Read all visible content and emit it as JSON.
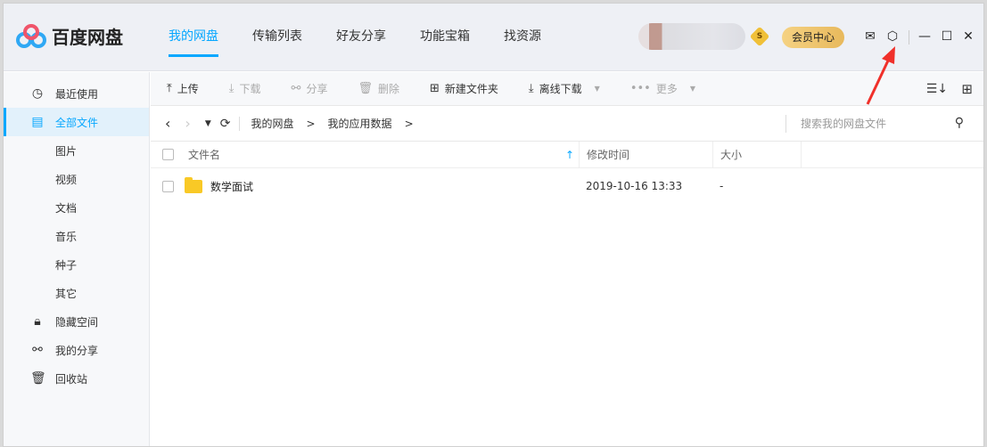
{
  "app": {
    "name": "百度网盘"
  },
  "nav": [
    "我的网盘",
    "传输列表",
    "好友分享",
    "功能宝箱",
    "找资源"
  ],
  "top": {
    "vip_badge": "S",
    "vip_center": "会员中心"
  },
  "sidebar": [
    {
      "label": "最近使用",
      "icon": "clock-icon",
      "glyph": "◷"
    },
    {
      "label": "全部文件",
      "icon": "document-icon",
      "glyph": "▤",
      "active": true
    },
    {
      "label": "图片"
    },
    {
      "label": "视频"
    },
    {
      "label": "文档"
    },
    {
      "label": "音乐"
    },
    {
      "label": "种子"
    },
    {
      "label": "其它"
    },
    {
      "label": "隐藏空间",
      "icon": "lock-icon",
      "glyph": "🔒︎"
    },
    {
      "label": "我的分享",
      "icon": "share-icon",
      "glyph": "⚯"
    },
    {
      "label": "回收站",
      "icon": "trash-icon",
      "glyph": "🗑︎"
    }
  ],
  "toolbar": {
    "upload": "上传",
    "download": "下载",
    "share": "分享",
    "delete": "删除",
    "new_folder": "新建文件夹",
    "offline": "离线下载",
    "more": "更多"
  },
  "path": {
    "crumbs": [
      "我的网盘",
      ">",
      "我的应用数据",
      ">"
    ],
    "search_placeholder": "搜索我的网盘文件"
  },
  "table": {
    "headers": [
      "文件名",
      "修改时间",
      "大小"
    ],
    "rows": [
      {
        "name": "数学面试",
        "modified": "2019-10-16 13:33",
        "size": "-"
      }
    ]
  },
  "colors": {
    "accent": "#06a7ff",
    "annotation": "#f0302a"
  }
}
